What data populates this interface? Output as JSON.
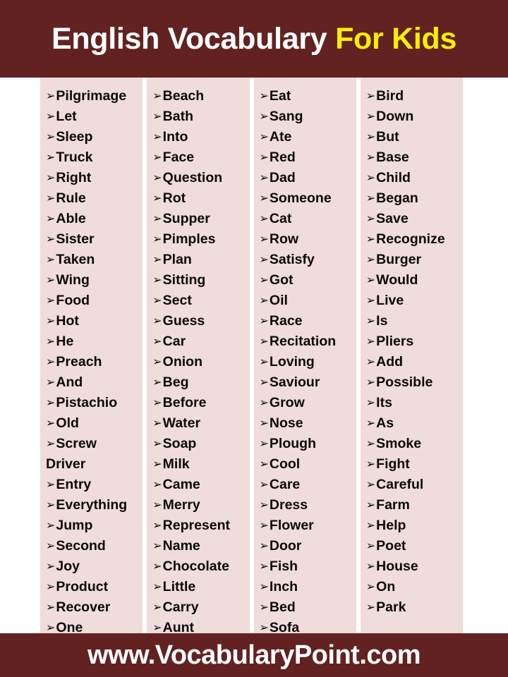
{
  "header": {
    "title_part_a": "English Vocabulary",
    "title_part_b": "For Kids",
    "background_color": "#622222",
    "title_color_a": "#FFFFFF",
    "title_color_b": "#FFEF00"
  },
  "footer": {
    "website": "www.VocabularyPoint.com",
    "background_color": "#622222",
    "text_color": "#FFFFFF"
  },
  "bullet_glyph": "➢",
  "panel_color": "#F0DCDA",
  "columns": [
    {
      "index": 1,
      "words": [
        {
          "text": "Pilgrimage",
          "bulleted": true
        },
        {
          "text": "Let",
          "bulleted": true
        },
        {
          "text": "Sleep",
          "bulleted": true
        },
        {
          "text": "Truck",
          "bulleted": true
        },
        {
          "text": "Right",
          "bulleted": true
        },
        {
          "text": "Rule",
          "bulleted": true
        },
        {
          "text": "Able",
          "bulleted": true
        },
        {
          "text": "Sister",
          "bulleted": true
        },
        {
          "text": "Taken",
          "bulleted": true
        },
        {
          "text": "Wing",
          "bulleted": true
        },
        {
          "text": "Food",
          "bulleted": true
        },
        {
          "text": "Hot",
          "bulleted": true
        },
        {
          "text": "He",
          "bulleted": true
        },
        {
          "text": "Preach",
          "bulleted": true
        },
        {
          "text": "And",
          "bulleted": true
        },
        {
          "text": "Pistachio",
          "bulleted": true
        },
        {
          "text": "Old",
          "bulleted": true
        },
        {
          "text": "Screw",
          "bulleted": true
        },
        {
          "text": "Driver",
          "bulleted": false
        },
        {
          "text": "Entry",
          "bulleted": true
        },
        {
          "text": "Everything",
          "bulleted": true
        },
        {
          "text": "Jump",
          "bulleted": true
        },
        {
          "text": "Second",
          "bulleted": true
        },
        {
          "text": "Joy",
          "bulleted": true
        },
        {
          "text": "Product",
          "bulleted": true
        },
        {
          "text": "Recover",
          "bulleted": true
        },
        {
          "text": "One",
          "bulleted": true
        }
      ]
    },
    {
      "index": 2,
      "words": [
        {
          "text": "Beach",
          "bulleted": true
        },
        {
          "text": "Bath",
          "bulleted": true
        },
        {
          "text": "Into",
          "bulleted": true
        },
        {
          "text": "Face",
          "bulleted": true
        },
        {
          "text": "Question",
          "bulleted": true
        },
        {
          "text": "Rot",
          "bulleted": true
        },
        {
          "text": "Supper",
          "bulleted": true
        },
        {
          "text": "Pimples",
          "bulleted": true
        },
        {
          "text": "Plan",
          "bulleted": true
        },
        {
          "text": "Sitting",
          "bulleted": true
        },
        {
          "text": "Sect",
          "bulleted": true
        },
        {
          "text": "Guess",
          "bulleted": true
        },
        {
          "text": "Car",
          "bulleted": true
        },
        {
          "text": "Onion",
          "bulleted": true
        },
        {
          "text": "Beg",
          "bulleted": true
        },
        {
          "text": "Before",
          "bulleted": true
        },
        {
          "text": "Water",
          "bulleted": true
        },
        {
          "text": "Soap",
          "bulleted": true
        },
        {
          "text": "Milk",
          "bulleted": true
        },
        {
          "text": "Came",
          "bulleted": true
        },
        {
          "text": "Merry",
          "bulleted": true
        },
        {
          "text": "Represent",
          "bulleted": true
        },
        {
          "text": "Name",
          "bulleted": true
        },
        {
          "text": "Chocolate",
          "bulleted": true
        },
        {
          "text": "Little",
          "bulleted": true
        },
        {
          "text": "Carry",
          "bulleted": true
        },
        {
          "text": "Aunt",
          "bulleted": true
        }
      ]
    },
    {
      "index": 3,
      "words": [
        {
          "text": "Eat",
          "bulleted": true
        },
        {
          "text": "Sang",
          "bulleted": true
        },
        {
          "text": "Ate",
          "bulleted": true
        },
        {
          "text": "Red",
          "bulleted": true
        },
        {
          "text": "Dad",
          "bulleted": true
        },
        {
          "text": "Someone",
          "bulleted": true
        },
        {
          "text": "Cat",
          "bulleted": true
        },
        {
          "text": "Row",
          "bulleted": true
        },
        {
          "text": "Satisfy",
          "bulleted": true
        },
        {
          "text": "Got",
          "bulleted": true
        },
        {
          "text": "Oil",
          "bulleted": true
        },
        {
          "text": "Race",
          "bulleted": true
        },
        {
          "text": "Recitation",
          "bulleted": true
        },
        {
          "text": "Loving",
          "bulleted": true
        },
        {
          "text": "Saviour",
          "bulleted": true
        },
        {
          "text": "Grow",
          "bulleted": true
        },
        {
          "text": "Nose",
          "bulleted": true
        },
        {
          "text": "Plough",
          "bulleted": true
        },
        {
          "text": "Cool",
          "bulleted": true
        },
        {
          "text": "Care",
          "bulleted": true
        },
        {
          "text": "Dress",
          "bulleted": true
        },
        {
          "text": "Flower",
          "bulleted": true
        },
        {
          "text": "Door",
          "bulleted": true
        },
        {
          "text": "Fish",
          "bulleted": true
        },
        {
          "text": "Inch",
          "bulleted": true
        },
        {
          "text": "Bed",
          "bulleted": true
        },
        {
          "text": "Sofa",
          "bulleted": true
        }
      ]
    },
    {
      "index": 4,
      "words": [
        {
          "text": "Bird",
          "bulleted": true
        },
        {
          "text": "Down",
          "bulleted": true
        },
        {
          "text": "But",
          "bulleted": true
        },
        {
          "text": "Base",
          "bulleted": true
        },
        {
          "text": "Child",
          "bulleted": true
        },
        {
          "text": "Began",
          "bulleted": true
        },
        {
          "text": "Save",
          "bulleted": true
        },
        {
          "text": "Recognize",
          "bulleted": true
        },
        {
          "text": "Burger",
          "bulleted": true
        },
        {
          "text": "Would",
          "bulleted": true
        },
        {
          "text": "Live",
          "bulleted": true
        },
        {
          "text": "Is",
          "bulleted": true
        },
        {
          "text": "Pliers",
          "bulleted": true
        },
        {
          "text": "Add",
          "bulleted": true
        },
        {
          "text": "Possible",
          "bulleted": true
        },
        {
          "text": "Its",
          "bulleted": true
        },
        {
          "text": "As",
          "bulleted": true
        },
        {
          "text": "Smoke",
          "bulleted": true
        },
        {
          "text": "Fight",
          "bulleted": true
        },
        {
          "text": "Careful",
          "bulleted": true
        },
        {
          "text": "Farm",
          "bulleted": true
        },
        {
          "text": "Help",
          "bulleted": true
        },
        {
          "text": "Poet",
          "bulleted": true
        },
        {
          "text": "House",
          "bulleted": true
        },
        {
          "text": "On",
          "bulleted": true
        },
        {
          "text": "Park",
          "bulleted": true
        }
      ]
    }
  ]
}
